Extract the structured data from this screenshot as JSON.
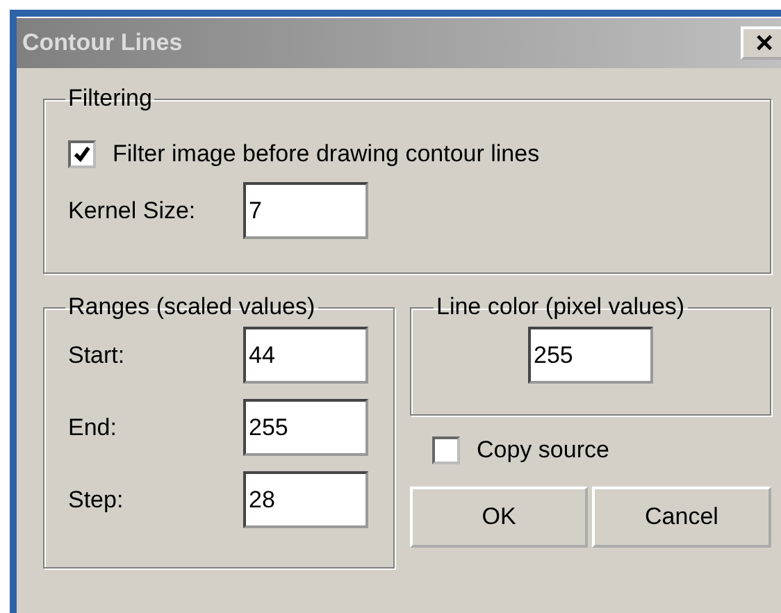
{
  "window": {
    "title": "Contour Lines",
    "close": "×"
  },
  "filtering": {
    "legend": "Filtering",
    "filter_checkbox": {
      "label": "Filter image before drawing contour lines",
      "checked": true
    },
    "kernel_size": {
      "label": "Kernel Size:",
      "value": "7"
    }
  },
  "ranges": {
    "legend": "Ranges (scaled values)",
    "fields": [
      {
        "label": "Start:",
        "value": "44"
      },
      {
        "label": "End:",
        "value": "255"
      },
      {
        "label": "Step:",
        "value": "28"
      }
    ]
  },
  "line_color": {
    "legend": "Line color (pixel values)",
    "value": "255"
  },
  "copy_source": {
    "label": "Copy source",
    "checked": false
  },
  "buttons": [
    "OK",
    "Cancel"
  ]
}
